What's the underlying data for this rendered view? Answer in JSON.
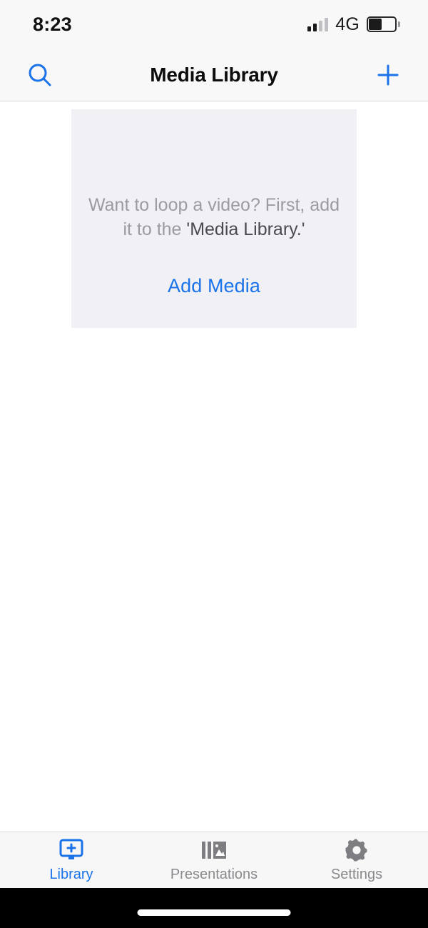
{
  "status_bar": {
    "time": "8:23",
    "network": "4G",
    "signal_icon": "signal-bars-icon",
    "signal_bars_active": 2,
    "signal_bars_total": 4,
    "battery_icon": "battery-icon",
    "battery_level_percent": 42
  },
  "nav_bar": {
    "title": "Media Library",
    "search_icon": "search-icon",
    "add_icon": "plus-icon",
    "accent_color": "#1a73e8"
  },
  "empty_state": {
    "message_prefix": "Want to loop a video? First, add it to the ",
    "message_emphasis": "'Media Library.'",
    "action_label": "Add Media",
    "card_background": "#f1f1f5",
    "text_color": "#9b9ba0",
    "emphasis_color": "#4a4a4f"
  },
  "tab_bar": {
    "active_color": "#1a73e8",
    "inactive_color": "#8a8a8e",
    "items": [
      {
        "label": "Library",
        "icon": "monitor-plus-icon",
        "active": true
      },
      {
        "label": "Presentations",
        "icon": "slides-image-icon",
        "active": false
      },
      {
        "label": "Settings",
        "icon": "gear-icon",
        "active": false
      }
    ]
  },
  "home_indicator": {
    "icon": "home-indicator-bar"
  }
}
